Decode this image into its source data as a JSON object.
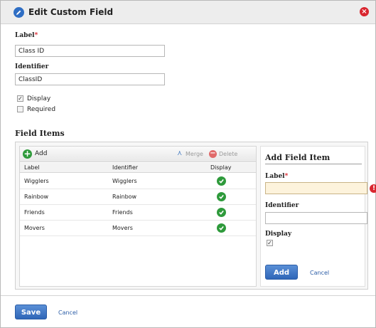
{
  "dialog": {
    "title": "Edit Custom Field",
    "close_icon": "close-icon"
  },
  "form": {
    "label_caption": "Label",
    "required_marker": "*",
    "label_value": "Class ID",
    "identifier_caption": "Identifier",
    "identifier_value": "ClassID",
    "display_label": "Display",
    "display_checked": true,
    "required_label": "Required",
    "required_checked": false
  },
  "field_items": {
    "section_title": "Field Items",
    "toolbar": {
      "add_label": "Add",
      "merge_label": "Merge",
      "delete_label": "Delete"
    },
    "columns": [
      "Label",
      "Identifier",
      "Display"
    ],
    "rows": [
      {
        "label": "Wigglers",
        "identifier": "Wigglers",
        "display": true
      },
      {
        "label": "Rainbow",
        "identifier": "Rainbow",
        "display": true
      },
      {
        "label": "Friends",
        "identifier": "Friends",
        "display": true
      },
      {
        "label": "Movers",
        "identifier": "Movers",
        "display": true
      }
    ]
  },
  "add_panel": {
    "title": "Add Field Item",
    "label_caption": "Label",
    "required_marker": "*",
    "label_value": "",
    "identifier_caption": "Identifier",
    "identifier_value": "",
    "display_caption": "Display",
    "display_checked": true,
    "add_button": "Add",
    "cancel_link": "Cancel"
  },
  "footer": {
    "save_button": "Save",
    "cancel_link": "Cancel"
  },
  "colors": {
    "accent": "#2f66b8",
    "success": "#2e9a3b",
    "danger": "#d9262f"
  }
}
